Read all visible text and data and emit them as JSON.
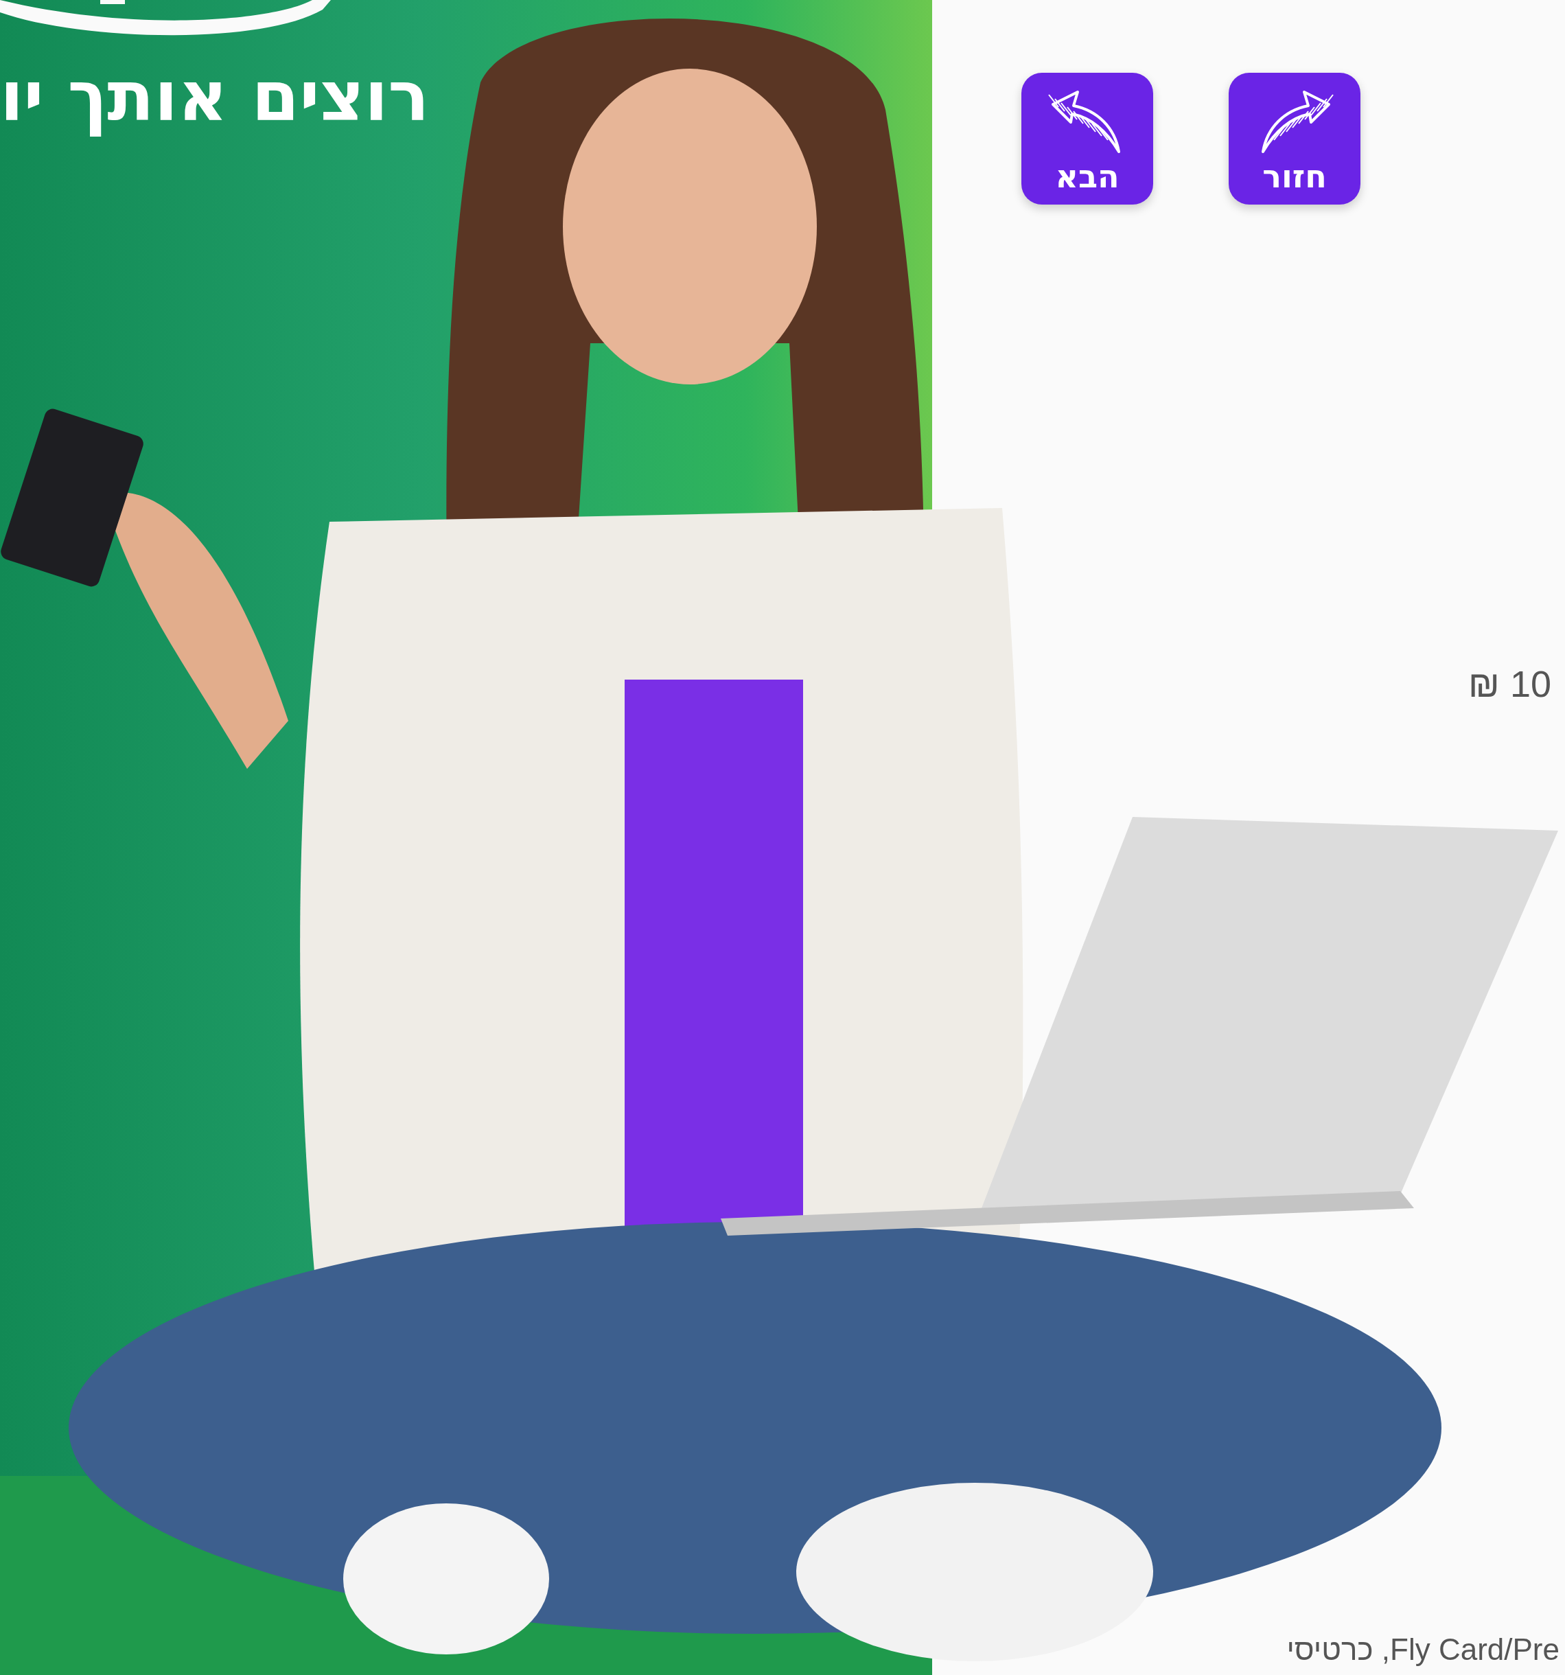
{
  "heading": "רוצים אותך יו",
  "nav_buttons": [
    {
      "label": "חזור",
      "kind": "back"
    },
    {
      "label": "הבא",
      "kind": "next"
    }
  ],
  "price": "10 ₪",
  "footnote": "Fly Card/Pre, כרטיסי"
}
